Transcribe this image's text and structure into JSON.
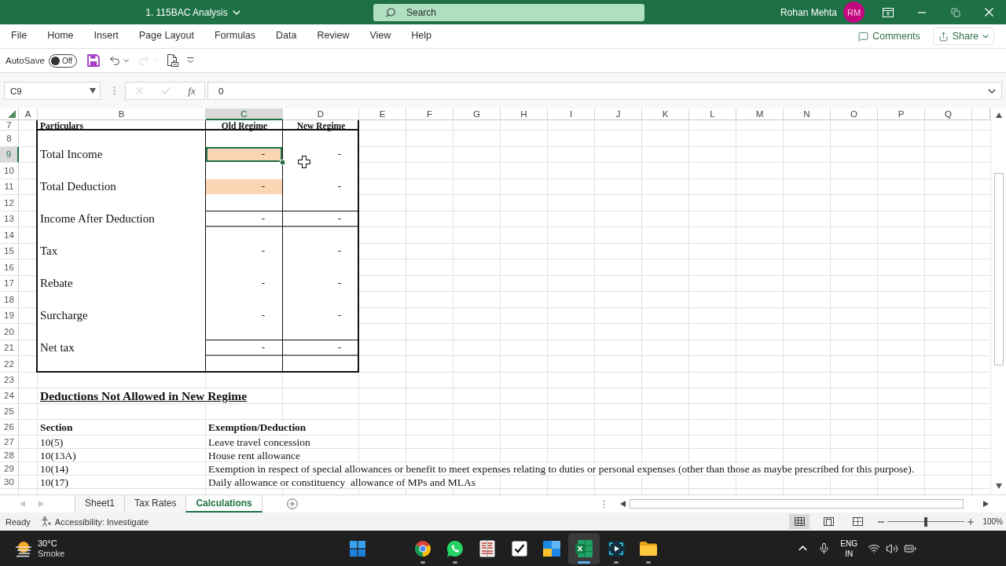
{
  "title_bar": {
    "document": "1. 115BAC Analysis",
    "search": {
      "placeholder": "Search"
    },
    "user": {
      "name": "Rohan Mehta",
      "initials": "RM"
    }
  },
  "ribbon_tabs": [
    {
      "label": "File",
      "selected": false
    },
    {
      "label": "Home",
      "selected": false
    },
    {
      "label": "Insert",
      "selected": false
    },
    {
      "label": "Page Layout",
      "selected": false
    },
    {
      "label": "Formulas",
      "selected": false
    },
    {
      "label": "Data",
      "selected": false
    },
    {
      "label": "Review",
      "selected": false
    },
    {
      "label": "View",
      "selected": false
    },
    {
      "label": "Help",
      "selected": false
    }
  ],
  "ribbon_actions": [
    {
      "kind": "comments",
      "label": "Comments"
    },
    {
      "kind": "share",
      "label": "Share"
    }
  ],
  "quick_access": {
    "autosave": {
      "label": "AutoSave",
      "on": false,
      "state_label": "Off"
    },
    "tools": [
      {
        "kind": "save",
        "disabled": false
      },
      {
        "kind": "undo",
        "disabled": false
      },
      {
        "kind": "redo",
        "disabled": true
      },
      {
        "kind": "print_preview",
        "disabled": false
      },
      {
        "kind": "customize",
        "disabled": false
      }
    ]
  },
  "formula_bar": {
    "name_box": "C9",
    "buttons": [
      {
        "kind": "cancel",
        "disabled": true
      },
      {
        "kind": "enter",
        "disabled": true
      }
    ],
    "function_label": "fx",
    "value": "0"
  },
  "columns": [
    {
      "label": "A",
      "selected": false
    },
    {
      "label": "B",
      "selected": false
    },
    {
      "label": "C",
      "selected": true
    },
    {
      "label": "D",
      "selected": false
    },
    {
      "label": "E",
      "selected": false
    },
    {
      "label": "F",
      "selected": false
    },
    {
      "label": "G",
      "selected": false
    },
    {
      "label": "H",
      "selected": false
    },
    {
      "label": "I",
      "selected": false
    },
    {
      "label": "J",
      "selected": false
    },
    {
      "label": "K",
      "selected": false
    },
    {
      "label": "L",
      "selected": false
    },
    {
      "label": "M",
      "selected": false
    },
    {
      "label": "N",
      "selected": false
    },
    {
      "label": "O",
      "selected": false
    },
    {
      "label": "P",
      "selected": false
    },
    {
      "label": "Q",
      "selected": false
    }
  ],
  "rows": [
    {
      "label": "7",
      "selected": false
    },
    {
      "label": "8",
      "selected": false
    },
    {
      "label": "9",
      "selected": true
    },
    {
      "label": "10",
      "selected": false
    },
    {
      "label": "11",
      "selected": false
    },
    {
      "label": "12",
      "selected": false
    },
    {
      "label": "13",
      "selected": false
    },
    {
      "label": "14",
      "selected": false
    },
    {
      "label": "15",
      "selected": false
    },
    {
      "label": "16",
      "selected": false
    },
    {
      "label": "17",
      "selected": false
    },
    {
      "label": "18",
      "selected": false
    },
    {
      "label": "19",
      "selected": false
    },
    {
      "label": "20",
      "selected": false
    },
    {
      "label": "21",
      "selected": false
    },
    {
      "label": "22",
      "selected": false
    },
    {
      "label": "23",
      "selected": false
    },
    {
      "label": "24",
      "selected": false
    },
    {
      "label": "25",
      "selected": false
    },
    {
      "label": "26",
      "selected": false
    },
    {
      "label": "27",
      "selected": false
    },
    {
      "label": "28",
      "selected": false
    },
    {
      "label": "29",
      "selected": false
    },
    {
      "label": "30",
      "selected": false
    }
  ],
  "comparison_table": {
    "headers": [
      "Particulars",
      "Old Regime",
      "New Regime"
    ],
    "items": [
      {
        "label": "Total Income",
        "kind": "plain",
        "values": [
          {
            "text": "-",
            "shaded": true,
            "selected": true
          },
          {
            "text": "-",
            "shaded": false,
            "selected": false
          }
        ]
      },
      {
        "label": "Total Deduction",
        "kind": "plain",
        "values": [
          {
            "text": "-",
            "shaded": true,
            "selected": false
          },
          {
            "text": "-",
            "shaded": false,
            "selected": false
          }
        ]
      },
      {
        "label": "Income After Deduction",
        "kind": "total",
        "values": [
          {
            "text": "-",
            "shaded": false,
            "selected": false
          },
          {
            "text": "-",
            "shaded": false,
            "selected": false
          }
        ]
      },
      {
        "label": "Tax",
        "kind": "plain",
        "values": [
          {
            "text": "-",
            "shaded": false,
            "selected": false
          },
          {
            "text": "-",
            "shaded": false,
            "selected": false
          }
        ]
      },
      {
        "label": "Rebate",
        "kind": "plain",
        "values": [
          {
            "text": "-",
            "shaded": false,
            "selected": false
          },
          {
            "text": "-",
            "shaded": false,
            "selected": false
          }
        ]
      },
      {
        "label": "Surcharge",
        "kind": "plain",
        "values": [
          {
            "text": "-",
            "shaded": false,
            "selected": false
          },
          {
            "text": "-",
            "shaded": false,
            "selected": false
          }
        ]
      },
      {
        "label": "Net tax",
        "kind": "total",
        "values": [
          {
            "text": "-",
            "shaded": false,
            "selected": false
          },
          {
            "text": "-",
            "shaded": false,
            "selected": false
          }
        ]
      }
    ]
  },
  "deductions": {
    "title": "Deductions Not Allowed in New Regime",
    "headers": [
      "Section",
      "Exemption/Deduction"
    ],
    "rows": [
      {
        "section": "10(5)",
        "exemption": "Leave travel concession"
      },
      {
        "section": "10(13A)",
        "exemption": "House rent allowance"
      },
      {
        "section": "10(14)",
        "exemption": "Exemption in respect of special allowances or benefit to meet expenses relating to duties or personal expenses (other than those as maybe prescribed for this purpose)."
      },
      {
        "section": "10(17)",
        "exemption": "Daily allowance or constituency  allowance of MPs and MLAs"
      }
    ]
  },
  "sheet_nav": [
    {
      "kind": "previous",
      "disabled": true
    },
    {
      "kind": "next",
      "disabled": true
    }
  ],
  "sheet_tabs": [
    {
      "label": "Sheet1",
      "selected": false
    },
    {
      "label": "Tax Rates",
      "selected": false
    },
    {
      "label": "Calculations",
      "selected": true
    }
  ],
  "status_bar": {
    "mode": "Ready",
    "accessibility": "Accessibility: Investigate",
    "views": [
      {
        "kind": "normal",
        "selected": true
      },
      {
        "kind": "page_layout",
        "selected": false
      },
      {
        "kind": "page_break",
        "selected": false
      }
    ],
    "zoom": {
      "level": 0.5,
      "label": "100%"
    }
  },
  "taskbar": {
    "weather": {
      "temperature": "30°C",
      "condition": "Smoke"
    },
    "apps": [
      {
        "kind": "start",
        "running": false,
        "active": false
      },
      {
        "kind": "browser",
        "running": true,
        "active": false
      },
      {
        "kind": "chat",
        "running": true,
        "active": false
      },
      {
        "kind": "book",
        "running": false,
        "active": false
      },
      {
        "kind": "tasks",
        "running": false,
        "active": false
      },
      {
        "kind": "window",
        "running": false,
        "active": false
      },
      {
        "kind": "spreadsheet",
        "running": true,
        "active": true
      },
      {
        "kind": "screen_capture",
        "running": true,
        "active": false
      },
      {
        "kind": "folder",
        "running": true,
        "active": false
      }
    ],
    "tray": {
      "language": "ENG",
      "region": "IN"
    }
  }
}
